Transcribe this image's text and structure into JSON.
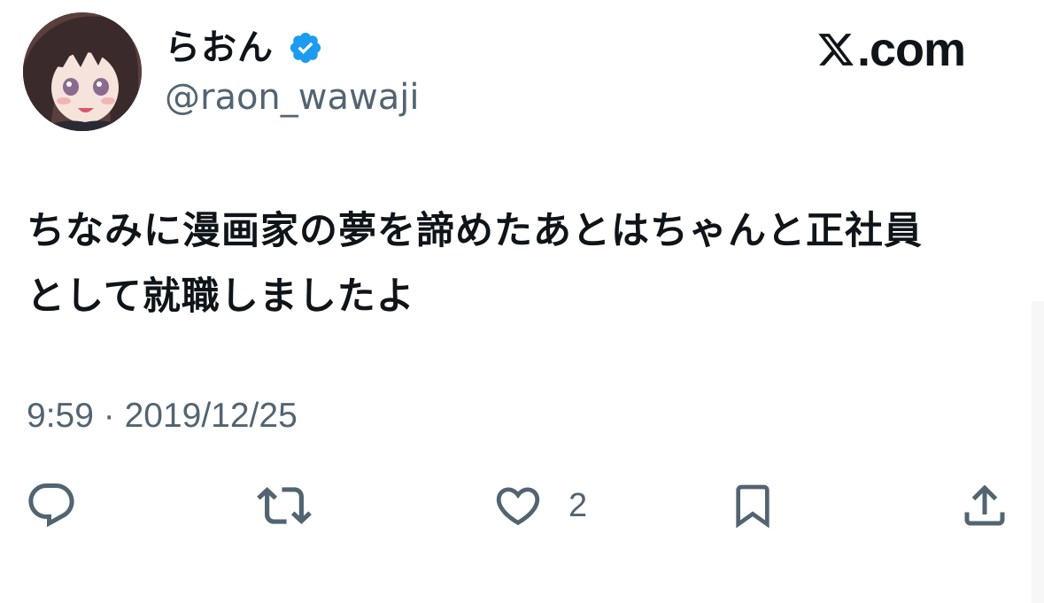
{
  "author": {
    "display_name": "らおん",
    "handle": "@raon_wawaji",
    "verified": true
  },
  "brand": {
    "domain": ".com"
  },
  "tweet": {
    "text": "ちなみに漫画家の夢を諦めたあとはちゃんと正社員\nとして就職しましたよ",
    "timestamp": "9:59 · 2019/12/25"
  },
  "actions": {
    "like_count": "2"
  },
  "icons": {
    "verified": "verified-badge-icon",
    "reply": "reply-icon",
    "retweet": "retweet-icon",
    "like": "heart-icon",
    "bookmark": "bookmark-icon",
    "share": "share-icon"
  },
  "colors": {
    "text": "#0f1419",
    "secondary": "#536471",
    "verified": "#1d9bf0"
  }
}
